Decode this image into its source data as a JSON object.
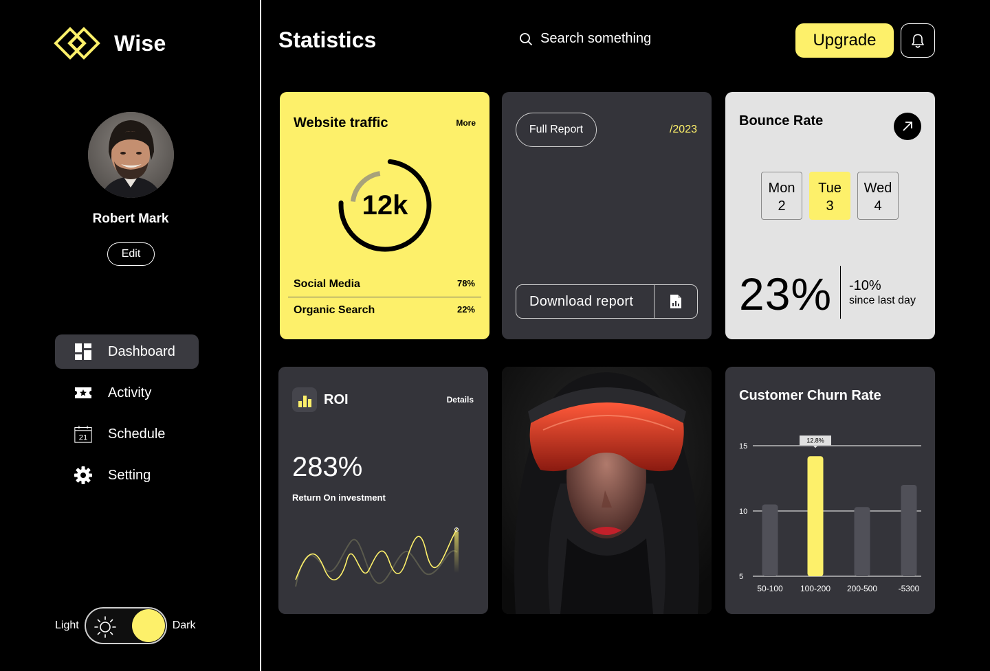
{
  "brand": {
    "name": "Wise",
    "accent": "#fdf06a"
  },
  "profile": {
    "name": "Robert Mark",
    "edit_label": "Edit"
  },
  "nav": [
    {
      "label": "Dashboard",
      "icon": "dashboard-icon",
      "active": true
    },
    {
      "label": "Activity",
      "icon": "ticket-icon",
      "active": false
    },
    {
      "label": "Schedule",
      "icon": "calendar-icon",
      "active": false,
      "icon_text": "21"
    },
    {
      "label": "Setting",
      "icon": "gear-icon",
      "active": false
    }
  ],
  "theme": {
    "light_label": "Light",
    "dark_label": "Dark",
    "mode": "dark"
  },
  "header": {
    "title": "Statistics",
    "search_placeholder": "Search something",
    "upgrade_label": "Upgrade"
  },
  "traffic": {
    "title": "Website traffic",
    "more_label": "More",
    "total": "12k",
    "sources": [
      {
        "name": "Social Media",
        "percent": "78%"
      },
      {
        "name": "Organic Search",
        "percent": "22%"
      }
    ]
  },
  "report": {
    "full_label": "Full Report",
    "year": "/2023",
    "download_label": "Download report"
  },
  "bounce": {
    "title": "Bounce Rate",
    "days": [
      {
        "name": "Mon",
        "num": "2",
        "selected": false
      },
      {
        "name": "Tue",
        "num": "3",
        "selected": true
      },
      {
        "name": "Wed",
        "num": "4",
        "selected": false
      }
    ],
    "value": "23%",
    "change": "-10%",
    "change_label": "since last day"
  },
  "roi": {
    "title": "ROI",
    "details_label": "Details",
    "value": "283%",
    "subtitle": "Return On  investment"
  },
  "churn": {
    "title": "Customer Churn Rate"
  },
  "chart_data": {
    "type": "bar",
    "categories": [
      "50-100",
      "100-200",
      "200-500",
      "-5300"
    ],
    "values": [
      10.5,
      14.2,
      10.3,
      12.0
    ],
    "highlight_index": 1,
    "annotation": "12.8%",
    "yticks": [
      5,
      10,
      15
    ],
    "ylim": [
      5,
      15
    ],
    "grid": true,
    "colors": {
      "bar": "#505058",
      "highlight": "#fdf06a"
    }
  }
}
